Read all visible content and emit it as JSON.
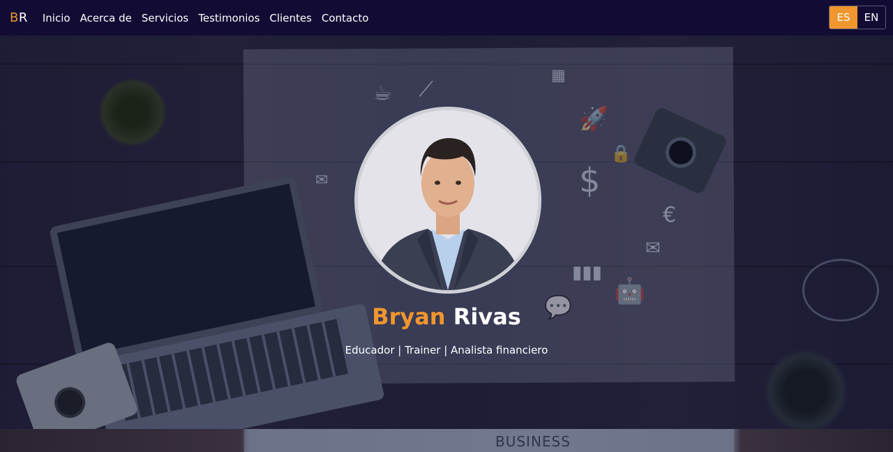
{
  "brand": {
    "first_letter": "B",
    "second_letter": "R"
  },
  "nav": {
    "items": [
      {
        "label": "Inicio"
      },
      {
        "label": "Acerca de"
      },
      {
        "label": "Servicios"
      },
      {
        "label": "Testimonios"
      },
      {
        "label": "Clientes"
      },
      {
        "label": "Contacto"
      }
    ]
  },
  "language": {
    "options": [
      {
        "label": "ES",
        "active": true
      },
      {
        "label": "EN",
        "active": false
      }
    ]
  },
  "hero": {
    "first_name": "Bryan",
    "last_name": "Rivas",
    "subtitle": "Educador | Trainer | Analista financiero"
  },
  "next_section": {
    "background_word": "BUSINESS"
  },
  "colors": {
    "accent": "#f0962e",
    "navbar": "#120c35",
    "overlay": "#121a3c"
  }
}
